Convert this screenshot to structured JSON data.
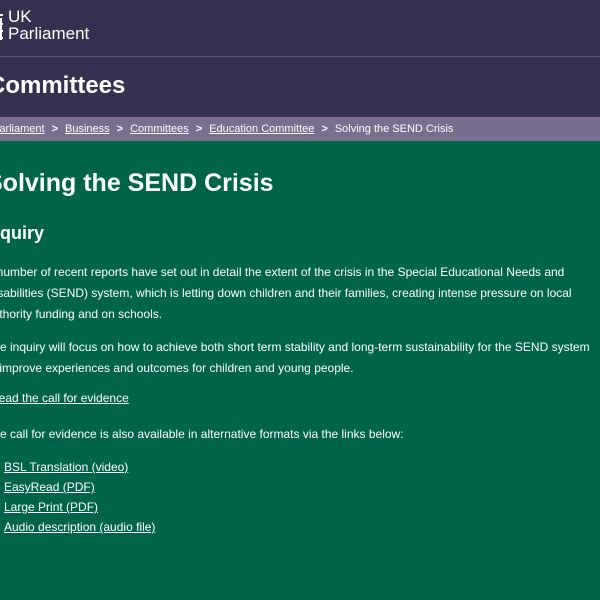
{
  "header": {
    "logo_line1": "UK",
    "logo_line2": "Parliament"
  },
  "band": {
    "title": "Committees"
  },
  "breadcrumb": {
    "items": [
      "Parliament",
      "Business",
      "Committees",
      "Education Committee"
    ],
    "current": "Solving the SEND Crisis",
    "separator": ">"
  },
  "main": {
    "title": "Solving the SEND Crisis",
    "section": "Inquiry",
    "paragraph1": "A number of recent reports have set out in detail the extent of the crisis in the Special Educational Needs and Disabilities (SEND) system, which is letting down children and their families, creating intense pressure on local authority funding and on schools.",
    "paragraph2": "The inquiry will focus on how to achieve both short term stability and long-term sustainability for the SEND system to improve experiences and outcomes for children and young people.",
    "read_link": "Read the call for evidence",
    "paragraph3": "The call for evidence is also available in alternative formats via the links below:",
    "formats": [
      "BSL Translation (video)",
      "EasyRead (PDF)",
      "Large Print (PDF)",
      "Audio description (audio file)"
    ]
  }
}
